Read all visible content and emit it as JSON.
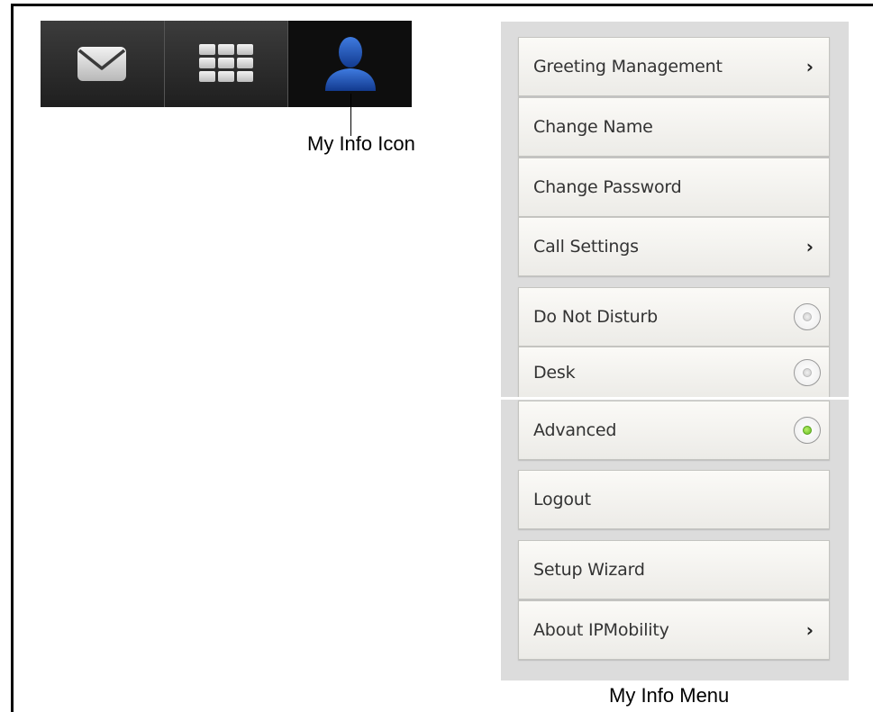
{
  "tabs": [
    {
      "name": "Mail",
      "icon": "mail-icon",
      "active": false
    },
    {
      "name": "Keypad",
      "icon": "keypad-icon",
      "active": false
    },
    {
      "name": "My Info",
      "icon": "my-info-person-icon",
      "active": true
    }
  ],
  "callout": {
    "label": "My Info Icon"
  },
  "menu": {
    "items": {
      "greeting_management": "Greeting Management",
      "change_name": "Change Name",
      "change_password": "Change Password",
      "call_settings": "Call Settings",
      "do_not_disturb": "Do Not Disturb",
      "desk": "Desk",
      "advanced": "Advanced",
      "logout": "Logout",
      "setup_wizard": "Setup Wizard",
      "about": "About IPMobility"
    },
    "selected_mode": "Advanced",
    "caption": "My Info Menu"
  },
  "colors": {
    "tab_bar": "#2a2a2a",
    "person_icon": "#1f4fb0",
    "radio_on": "#7ed03a",
    "menu_bg": "#dcdcdc"
  }
}
